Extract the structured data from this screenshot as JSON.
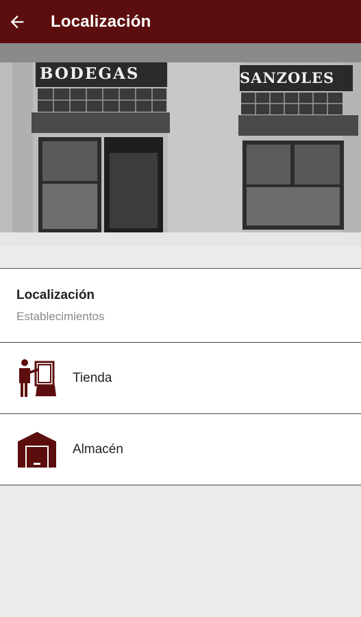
{
  "appbar": {
    "title": "Localización",
    "back_icon": "arrow-left-icon",
    "background": "#5c0e0e"
  },
  "hero": {
    "sign_left": "BODEGAS",
    "sign_right": "SANZOLES"
  },
  "section": {
    "title": "Localización",
    "subtitle": "Establecimientos"
  },
  "items": [
    {
      "label": "Tienda",
      "icon": "shop-clerk-icon"
    },
    {
      "label": "Almacén",
      "icon": "warehouse-icon"
    }
  ],
  "colors": {
    "accent": "#5c0e0e"
  }
}
